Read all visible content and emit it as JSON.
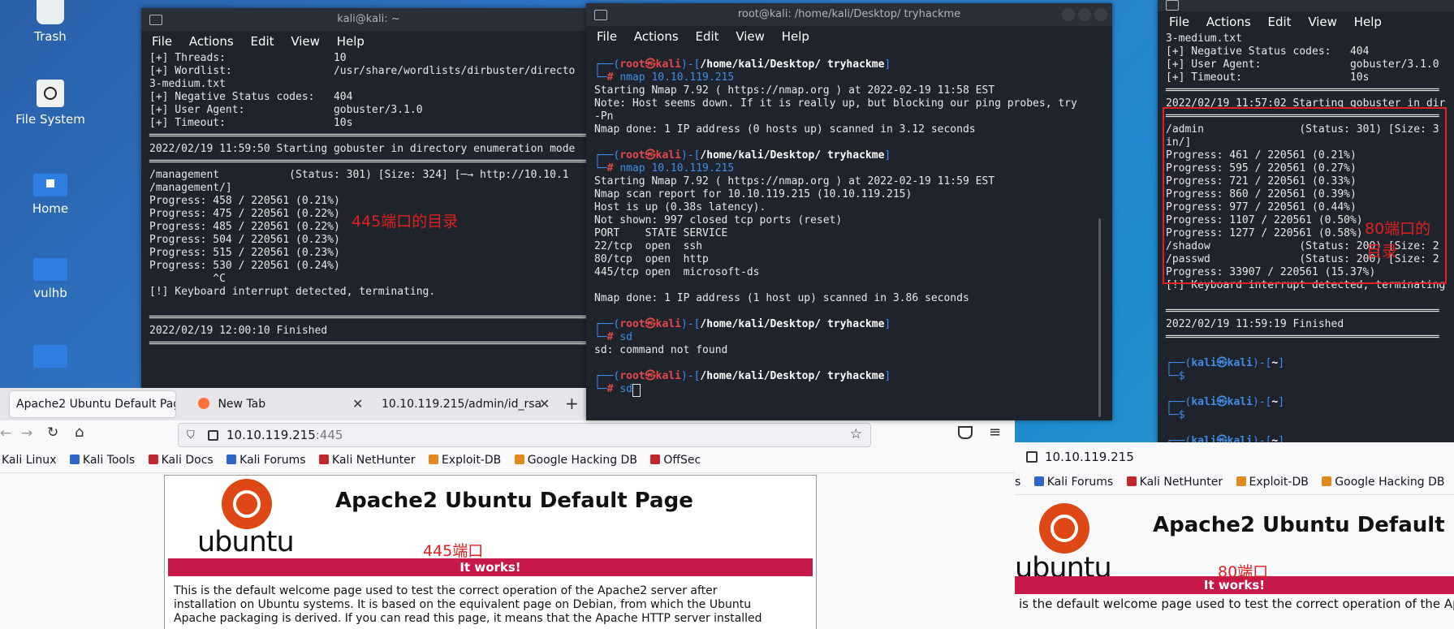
{
  "desktop": {
    "icons": [
      {
        "label": "Trash"
      },
      {
        "label": "File System"
      },
      {
        "label": "Home"
      },
      {
        "label": "vulhb"
      }
    ]
  },
  "term1": {
    "title": "kali@kali: ~",
    "menu": [
      "File",
      "Actions",
      "Edit",
      "View",
      "Help"
    ],
    "lines": [
      "[+] Threads:                 10",
      "[+] Wordlist:                /usr/share/wordlists/dirbuster/directo",
      "3-medium.txt",
      "[+] Negative Status codes:   404",
      "[+] User Agent:              gobuster/3.1.0",
      "[+] Timeout:                 10s",
      "═══════════════════════════════════════════════════════════════════════════",
      "2022/02/19 11:59:50 Starting gobuster in directory enumeration mode",
      "═══════════════════════════════════════════════════════════════════════════",
      "/management           (Status: 301) [Size: 324] [─→ http://10.10.1",
      "/management/]",
      "Progress: 458 / 220561 (0.21%)",
      "Progress: 475 / 220561 (0.22%)",
      "Progress: 485 / 220561 (0.22%)",
      "Progress: 504 / 220561 (0.23%)",
      "Progress: 515 / 220561 (0.23%)",
      "Progress: 530 / 220561 (0.24%)",
      "          ^C",
      "[!] Keyboard interrupt detected, terminating.",
      "",
      "═══════════════════════════════════════════════════════════════════════════",
      "2022/02/19 12:00:10 Finished",
      "═══════════════════════════════════════════════════════════════════════════"
    ],
    "annotation": "445端口的目录"
  },
  "term2": {
    "title": "root@kali: /home/kali/Desktop/ tryhackme",
    "menu": [
      "File",
      "Actions",
      "Edit",
      "View",
      "Help"
    ],
    "prompt_user": "root",
    "prompt_host": "kali",
    "prompt_path": "/home/kali/Desktop/ tryhackme",
    "blocks": [
      {
        "cmd": "nmap 10.10.119.215",
        "out": [
          "Starting Nmap 7.92 ( https://nmap.org ) at 2022-02-19 11:58 EST",
          "Note: Host seems down. If it is really up, but blocking our ping probes, try",
          "-Pn",
          "Nmap done: 1 IP address (0 hosts up) scanned in 3.12 seconds"
        ]
      },
      {
        "cmd": "nmap 10.10.119.215",
        "out": [
          "Starting Nmap 7.92 ( https://nmap.org ) at 2022-02-19 11:59 EST",
          "Nmap scan report for 10.10.119.215 (10.10.119.215)",
          "Host is up (0.38s latency).",
          "Not shown: 997 closed tcp ports (reset)",
          "PORT    STATE SERVICE",
          "22/tcp  open  ssh",
          "80/tcp  open  http",
          "445/tcp open  microsoft-ds",
          "",
          "Nmap done: 1 IP address (1 host up) scanned in 3.86 seconds"
        ]
      },
      {
        "cmd": "sd",
        "out": [
          "sd: command not found"
        ]
      },
      {
        "cmd": "sd",
        "out": []
      }
    ]
  },
  "term3": {
    "menu": [
      "File",
      "Actions",
      "Edit",
      "View",
      "Help"
    ],
    "lines": [
      "3-medium.txt",
      "[+] Negative Status codes:   404",
      "[+] User Agent:              gobuster/3.1.0",
      "[+] Timeout:                 10s",
      "═══════════════════════════════════════════",
      "2022/02/19 11:57:02 Starting gobuster in dir",
      "═══════════════════════════════════════════",
      "/admin               (Status: 301) [Size: 3",
      "in/]",
      "Progress: 461 / 220561 (0.21%)",
      "Progress: 595 / 220561 (0.27%)",
      "Progress: 721 / 220561 (0.33%)",
      "Progress: 860 / 220561 (0.39%)",
      "Progress: 977 / 220561 (0.44%)",
      "Progress: 1107 / 220561 (0.50%)",
      "Progress: 1277 / 220561 (0.58%)",
      "/shadow              (Status: 200) [Size: 2",
      "/passwd              (Status: 200) [Size: 2",
      "Progress: 33907 / 220561 (15.37%)",
      "[!] Keyboard interrupt detected, terminating",
      "",
      "═══════════════════════════════════════════",
      "2022/02/19 11:59:19 Finished",
      "═══════════════════════════════════════════"
    ],
    "prompt_user": "kali",
    "prompt_host": "kali",
    "prompt_path": "~",
    "annotation_line1": "80端口的",
    "annotation_line2": "目录"
  },
  "browser1": {
    "tabs": [
      {
        "label": "Apache2 Ubuntu Default Pag"
      },
      {
        "label": "New Tab"
      },
      {
        "label": "10.10.119.215/admin/id_rsa"
      }
    ],
    "url_host": "10.10.119.215",
    "url_port": ":445",
    "bookmarks": [
      "Kali Linux",
      "Kali Tools",
      "Kali Docs",
      "Kali Forums",
      "Kali NetHunter",
      "Exploit-DB",
      "Google Hacking DB",
      "OffSec"
    ],
    "page_title": "Apache2 Ubuntu Default Page",
    "ubuntu": "ubuntu",
    "annotation": "445端口",
    "it_works": "It works!",
    "para": [
      "This is the default welcome page used to test the correct operation of the Apache2 server after",
      "installation on Ubuntu systems. It is based on the equivalent page on Debian, from which the Ubuntu",
      "Apache packaging is derived. If you can read this page, it means that the Apache HTTP server installed"
    ]
  },
  "browser2": {
    "url": "10.10.119.215",
    "bookmarks": [
      "s",
      "Kali Forums",
      "Kali NetHunter",
      "Exploit-DB",
      "Google Hacking DB"
    ],
    "page_title": "Apache2 Ubuntu Default",
    "ubuntu": "ubuntu",
    "annotation": "80端口",
    "it_works": "It works!",
    "para": [
      "is the default welcome page used to test the correct operation of the Ap"
    ]
  },
  "colors": {
    "annotation": "#e02020",
    "ubuntu_orange": "#dd4814",
    "it_works": "#c7184a"
  }
}
